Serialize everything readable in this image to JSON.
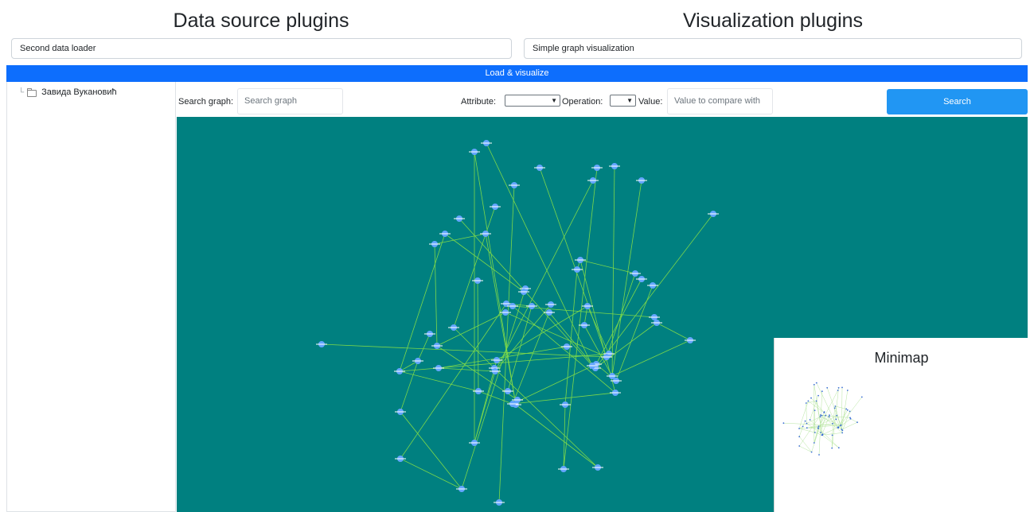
{
  "header": {
    "data_source_title": "Data source plugins",
    "visualization_title": "Visualization plugins",
    "data_source_selected": "Second data loader",
    "visualization_selected": "Simple graph visualization"
  },
  "load_button": "Load & visualize",
  "sidebar": {
    "tree_root": "Завида Вукановић"
  },
  "toolbar": {
    "search_label": "Search graph:",
    "search_placeholder": "Search graph",
    "attribute_label": "Attribute:",
    "operation_label": "Operation:",
    "value_label": "Value:",
    "value_placeholder": "Value to compare with",
    "search_button": "Search"
  },
  "canvas": {
    "background": "#008080",
    "node_color": "#64a6ff",
    "edge_color": "#7cd84a"
  },
  "minimap": {
    "title": "Minimap"
  },
  "accent": "#0d6efd",
  "search_button_color": "#2196f3"
}
